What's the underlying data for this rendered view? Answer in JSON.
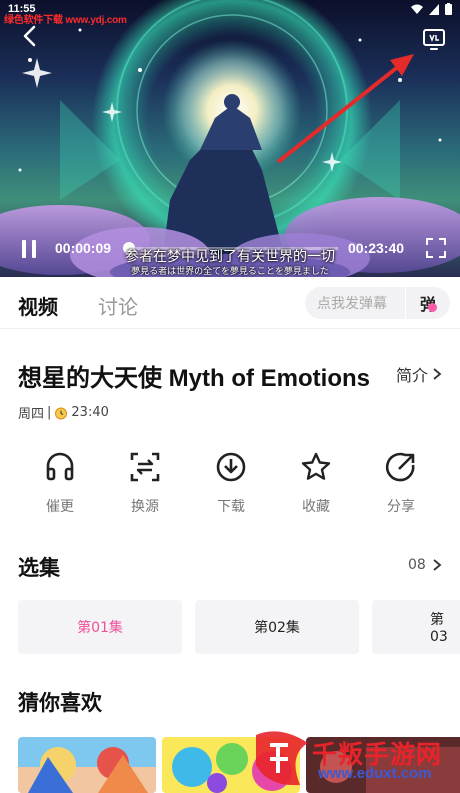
{
  "status_bar": {
    "time": "11:55",
    "watermark": "绿色软件下载 www.ydj.com"
  },
  "player": {
    "current_time": "00:00:09",
    "total_time": "00:23:40",
    "progress": 0.0063,
    "subtitle_main": "参者在梦中见到了有关世界的一切",
    "subtitle_sub": "夢見る者は世界の全てを夢見ることを夢見ました"
  },
  "tabs": [
    {
      "label": "视频",
      "active": true
    },
    {
      "label": "讨论",
      "active": false
    }
  ],
  "danmaku": {
    "placeholder": "点我发弹幕",
    "button": "弹"
  },
  "anime": {
    "title": "想星的大天使 Myth of Emotions",
    "intro_label": "简介",
    "schedule_day": "周四",
    "schedule_sep": "|",
    "schedule_time": "23:40"
  },
  "actions": [
    {
      "label": "催更",
      "icon": "headphones-icon"
    },
    {
      "label": "换源",
      "icon": "switch-source-icon"
    },
    {
      "label": "下载",
      "icon": "download-icon"
    },
    {
      "label": "收藏",
      "icon": "star-icon"
    },
    {
      "label": "分享",
      "icon": "share-icon"
    }
  ],
  "episodes": {
    "section_title": "选集",
    "count": "08",
    "items": [
      {
        "label": "第01集",
        "active": true
      },
      {
        "label": "第02集",
        "active": false
      },
      {
        "label": "第03",
        "active": false
      }
    ]
  },
  "recommend": {
    "section_title": "猜你喜欢"
  },
  "overlay_watermark": {
    "text": "千叛手游网",
    "url": "www.eduxt.com"
  },
  "colors": {
    "accent": "#f0509a",
    "watermark_red": "#e8232a"
  }
}
